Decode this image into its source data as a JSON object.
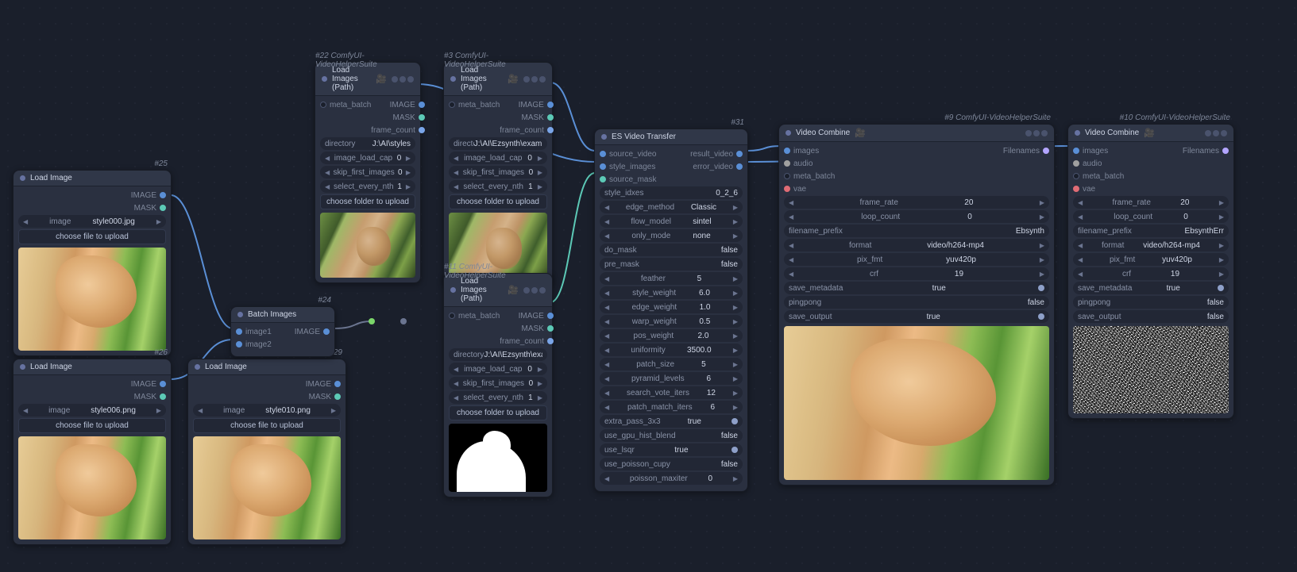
{
  "nodes": {
    "n25": {
      "id": "#25",
      "title": "Load Image",
      "file_label": "image",
      "file_value": "style000.jpg",
      "upload": "choose file to upload",
      "out": [
        "IMAGE",
        "MASK"
      ]
    },
    "n26": {
      "id": "#26",
      "title": "Load Image",
      "file_label": "image",
      "file_value": "style006.png",
      "upload": "choose file to upload",
      "out": [
        "IMAGE",
        "MASK"
      ]
    },
    "n29": {
      "id": "#29",
      "title": "Load Image",
      "file_label": "image",
      "file_value": "style010.png",
      "upload": "choose file to upload",
      "out": [
        "IMAGE",
        "MASK"
      ]
    },
    "n24": {
      "id": "#24",
      "title": "Batch Images",
      "in": [
        "image1",
        "image2"
      ],
      "out": [
        "IMAGE"
      ]
    },
    "n22": {
      "id": "#22 ComfyUI-VideoHelperSuite",
      "title": "Load Images (Path)",
      "in": [
        "meta_batch"
      ],
      "out": [
        "IMAGE",
        "MASK",
        "frame_count"
      ],
      "dir_label": "directory",
      "dir_value": "J:\\AI\\styles",
      "w": [
        [
          "image_load_cap",
          "0"
        ],
        [
          "skip_first_images",
          "0"
        ],
        [
          "select_every_nth",
          "1"
        ]
      ],
      "upload": "choose folder to upload"
    },
    "n3": {
      "id": "#3 ComfyUI-VideoHelperSuite",
      "title": "Load Images (Path)",
      "in": [
        "meta_batch"
      ],
      "out": [
        "IMAGE",
        "MASK",
        "frame_count"
      ],
      "dir_label": "directory",
      "dir_value": "J:\\AI\\Ezsynth\\examples\\input",
      "w": [
        [
          "image_load_cap",
          "0"
        ],
        [
          "skip_first_images",
          "0"
        ],
        [
          "select_every_nth",
          "1"
        ]
      ],
      "upload": "choose folder to upload"
    },
    "n11": {
      "id": "#11 ComfyUI-VideoHelperSuite",
      "title": "Load Images (Path)",
      "in": [
        "meta_batch"
      ],
      "out": [
        "IMAGE",
        "MASK",
        "frame_count"
      ],
      "dir_label": "directory",
      "dir_value": "J:\\AI\\Ezsynth\\examples\\mask\\ma",
      "w": [
        [
          "image_load_cap",
          "0"
        ],
        [
          "skip_first_images",
          "0"
        ],
        [
          "select_every_nth",
          "1"
        ]
      ],
      "upload": "choose folder to upload"
    },
    "n31": {
      "id": "#31",
      "title": "ES Video Transfer",
      "in": [
        "source_video",
        "style_images",
        "source_mask"
      ],
      "out": [
        "result_video",
        "error_video"
      ],
      "w": [
        [
          "style_idxes",
          "0_2_6",
          ""
        ],
        [
          "edge_method",
          "Classic",
          "combo"
        ],
        [
          "flow_model",
          "sintel",
          "combo"
        ],
        [
          "only_mode",
          "none",
          "combo"
        ],
        [
          "do_mask",
          "false",
          ""
        ],
        [
          "pre_mask",
          "false",
          ""
        ],
        [
          "feather",
          "5",
          "num"
        ],
        [
          "style_weight",
          "6.0",
          "num"
        ],
        [
          "edge_weight",
          "1.0",
          "num"
        ],
        [
          "warp_weight",
          "0.5",
          "num"
        ],
        [
          "pos_weight",
          "2.0",
          "num"
        ],
        [
          "uniformity",
          "3500.0",
          "num"
        ],
        [
          "patch_size",
          "5",
          "num"
        ],
        [
          "pyramid_levels",
          "6",
          "num"
        ],
        [
          "search_vote_iters",
          "12",
          "num"
        ],
        [
          "patch_match_iters",
          "6",
          "num"
        ],
        [
          "extra_pass_3x3",
          "true",
          "toggle"
        ],
        [
          "use_gpu_hist_blend",
          "false",
          ""
        ],
        [
          "use_lsqr",
          "true",
          "toggle"
        ],
        [
          "use_poisson_cupy",
          "false",
          ""
        ],
        [
          "poisson_maxiter",
          "0",
          "num"
        ]
      ]
    },
    "n9": {
      "id": "#9 ComfyUI-VideoHelperSuite",
      "title": "Video Combine",
      "in": [
        "images",
        "audio",
        "meta_batch",
        "vae"
      ],
      "out": [
        "Filenames"
      ],
      "w": [
        [
          "frame_rate",
          "20",
          "num"
        ],
        [
          "loop_count",
          "0",
          "num"
        ],
        [
          "filename_prefix",
          "Ebsynth",
          ""
        ],
        [
          "format",
          "video/h264-mp4",
          "combo"
        ],
        [
          "pix_fmt",
          "yuv420p",
          "combo"
        ],
        [
          "crf",
          "19",
          "num"
        ],
        [
          "save_metadata",
          "true",
          "toggle"
        ],
        [
          "pingpong",
          "false",
          ""
        ],
        [
          "save_output",
          "true",
          "toggle"
        ]
      ]
    },
    "n10": {
      "id": "#10 ComfyUI-VideoHelperSuite",
      "title": "Video Combine",
      "in": [
        "images",
        "audio",
        "meta_batch",
        "vae"
      ],
      "out": [
        "Filenames"
      ],
      "w": [
        [
          "frame_rate",
          "20",
          "num"
        ],
        [
          "loop_count",
          "0",
          "num"
        ],
        [
          "filename_prefix",
          "EbsynthErr",
          ""
        ],
        [
          "format",
          "video/h264-mp4",
          "combo"
        ],
        [
          "pix_fmt",
          "yuv420p",
          "combo"
        ],
        [
          "crf",
          "19",
          "num"
        ],
        [
          "save_metadata",
          "true",
          "toggle"
        ],
        [
          "pingpong",
          "false",
          ""
        ],
        [
          "save_output",
          "false",
          ""
        ]
      ]
    }
  }
}
